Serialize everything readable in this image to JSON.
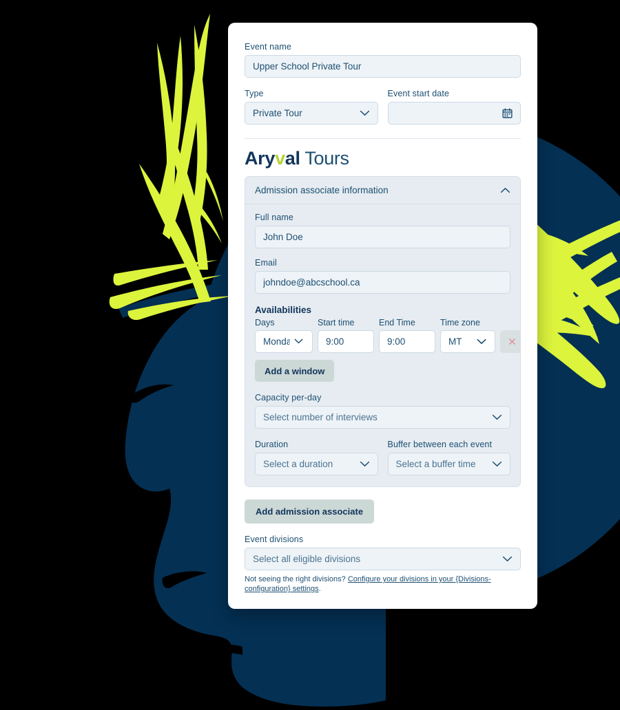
{
  "colors": {
    "navy": "#043053",
    "lime": "#dcf43c",
    "brand_navy": "#12355b",
    "brand_green": "#b5d334",
    "field_bg": "#eef3f7",
    "panel_bg": "#e6ecf1",
    "button_bg": "#ccd8d6",
    "delete_red": "#e48a92",
    "card_bg": "#ffffff"
  },
  "form": {
    "event_name": {
      "label": "Event name",
      "value": "Upper School Private Tour",
      "placeholder": "Event name"
    },
    "type": {
      "label": "Type",
      "value": "Private Tour",
      "icon": "chevron-down-icon"
    },
    "event_start_date": {
      "label": "Event start date",
      "value": "",
      "placeholder": "",
      "icon": "calendar-icon"
    }
  },
  "logo": {
    "part1": "Ary",
    "part_accent": "v",
    "part2": "al",
    "part3": " Tours",
    "full": "Aryval Tours"
  },
  "panel": {
    "title": "Admission associate information",
    "toggle_icon": "chevron-up-icon",
    "full_name": {
      "label": "Full name",
      "value": "John Doe"
    },
    "email": {
      "label": "Email",
      "value": "johndoe@abcschool.ca"
    },
    "availabilities": {
      "title": "Availabilities",
      "columns": [
        "Days",
        "Start time",
        "End Time",
        "Time zone"
      ],
      "rows": [
        {
          "day": "Monday",
          "start_time": "9:00",
          "end_time": "9:00",
          "time_zone": "MT",
          "delete_icon": "close-icon"
        }
      ],
      "add_window_label": "Add a window"
    },
    "capacity": {
      "label": "Capacity per-day",
      "placeholder": "Select number of interviews"
    },
    "duration": {
      "label": "Duration",
      "placeholder": "Select a duration"
    },
    "buffer": {
      "label": "Buffer between each event",
      "placeholder": "Select a buffer time"
    }
  },
  "actions": {
    "add_admission_associate": "Add admission associate"
  },
  "event_divisions": {
    "label": "Event divisions",
    "placeholder": "Select all eligible divisions",
    "helper_prefix": "Not seeing the right divisions? ",
    "helper_link": "Configure your divisions in your {Divisions-configuration} settings",
    "helper_suffix": "."
  }
}
